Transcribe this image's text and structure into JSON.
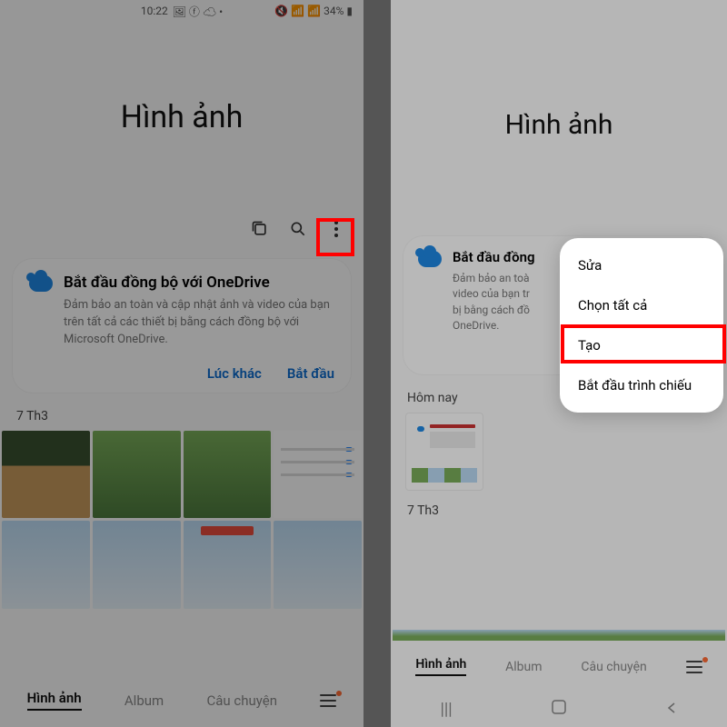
{
  "statusbar": {
    "time": "10:22",
    "battery": "34%"
  },
  "title": "Hình ảnh",
  "card": {
    "title": "Bắt đầu đồng bộ với OneDrive",
    "title_short": "Bắt đầu đồng",
    "desc": "Đảm bảo an toàn và cập nhật ảnh và video của bạn trên tất cả các thiết bị bằng cách đồng bộ với Microsoft OneDrive.",
    "desc_short1": "Đảm bảo an toà",
    "desc_short2": "video của bạn tr",
    "desc_short3": "bị bằng cách đồ",
    "desc_short4": "OneDrive.",
    "later": "Lúc khác",
    "start": "Bắt đầu"
  },
  "sections": {
    "date1": "7 Th3",
    "today": "Hôm nay"
  },
  "tabs": {
    "photos": "Hình ảnh",
    "album": "Album",
    "story": "Câu chuyện"
  },
  "menu": {
    "edit": "Sửa",
    "select_all": "Chọn tất cả",
    "create": "Tạo",
    "slideshow": "Bắt đầu trình chiếu"
  }
}
